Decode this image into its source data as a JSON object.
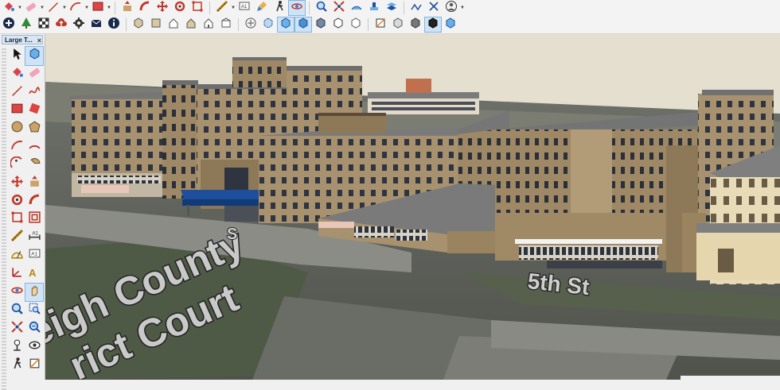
{
  "tray": {
    "title": "Large T...",
    "close_glyph": "×"
  },
  "toolbar_row1": [
    {
      "name": "paint-bucket-icon",
      "dd": true
    },
    {
      "name": "eraser-icon",
      "dd": true
    },
    {
      "name": "pencil-line-icon",
      "dd": true
    },
    {
      "name": "arc-icon",
      "dd": true
    },
    {
      "name": "rectangle-icon",
      "dd": true
    },
    {
      "name": "push-pull-icon"
    },
    {
      "name": "follow-me-icon"
    },
    {
      "name": "move-icon"
    },
    {
      "name": "rotate-icon"
    },
    {
      "name": "scale-icon"
    },
    {
      "name": "tape-measure-icon",
      "dd": true
    },
    {
      "name": "text-label-icon"
    },
    {
      "name": "paint-brush-icon"
    },
    {
      "name": "walk-icon"
    },
    {
      "name": "orbit-icon",
      "active": true
    },
    {
      "name": "zoom-icon"
    },
    {
      "name": "zoom-extents-icon"
    },
    {
      "name": "sandbox-smoove-icon"
    },
    {
      "name": "stamp-icon"
    },
    {
      "name": "drape-icon"
    },
    {
      "name": "add-detail-icon"
    },
    {
      "name": "flip-edge-icon"
    },
    {
      "name": "user-account-icon",
      "dd": true
    }
  ],
  "toolbar_row2": [
    {
      "name": "add-location-icon"
    },
    {
      "name": "tree-icon"
    },
    {
      "name": "checkerboard-icon"
    },
    {
      "name": "cloud-upload-icon"
    },
    {
      "name": "extensions-gear-icon"
    },
    {
      "name": "mail-icon"
    },
    {
      "name": "info-icon"
    },
    {
      "name": "iso-view-icon"
    },
    {
      "name": "top-view-icon"
    },
    {
      "name": "front-view-icon"
    },
    {
      "name": "right-view-icon"
    },
    {
      "name": "back-view-icon"
    },
    {
      "name": "left-view-icon"
    },
    {
      "name": "xray-icon"
    },
    {
      "name": "back-edges-icon"
    },
    {
      "name": "wireframe-icon",
      "active": true
    },
    {
      "name": "hidden-line-icon",
      "active": true
    },
    {
      "name": "shaded-icon"
    },
    {
      "name": "shaded-textures-icon"
    },
    {
      "name": "monochrome-icon"
    },
    {
      "name": "section-plane-icon"
    },
    {
      "name": "section-cut-icon"
    },
    {
      "name": "section-fill-icon"
    },
    {
      "name": "display-sections-icon",
      "active": true
    },
    {
      "name": "shadow-toggle-icon"
    }
  ],
  "tray_tools": [
    {
      "name": "select-arrow-icon"
    },
    {
      "name": "make-component-icon",
      "active": true
    },
    {
      "name": "paint-bucket-icon"
    },
    {
      "name": "eraser-icon"
    },
    {
      "name": "line-pencil-icon"
    },
    {
      "name": "freehand-icon"
    },
    {
      "name": "rectangle-icon"
    },
    {
      "name": "rotated-rectangle-icon"
    },
    {
      "name": "circle-icon"
    },
    {
      "name": "polygon-icon"
    },
    {
      "name": "arc-icon"
    },
    {
      "name": "two-point-arc-icon"
    },
    {
      "name": "three-point-arc-icon"
    },
    {
      "name": "pie-icon"
    },
    {
      "name": "move-icon"
    },
    {
      "name": "push-pull-icon"
    },
    {
      "name": "rotate-icon"
    },
    {
      "name": "follow-me-icon"
    },
    {
      "name": "scale-icon"
    },
    {
      "name": "offset-icon"
    },
    {
      "name": "tape-measure-icon"
    },
    {
      "name": "dimension-icon"
    },
    {
      "name": "protractor-icon"
    },
    {
      "name": "text-icon"
    },
    {
      "name": "axes-icon"
    },
    {
      "name": "3d-text-icon"
    },
    {
      "name": "orbit-icon"
    },
    {
      "name": "pan-hand-icon",
      "active": true
    },
    {
      "name": "zoom-icon"
    },
    {
      "name": "zoom-window-icon"
    },
    {
      "name": "zoom-extents-icon"
    },
    {
      "name": "previous-view-icon"
    },
    {
      "name": "position-camera-icon"
    },
    {
      "name": "look-around-icon"
    },
    {
      "name": "walk-icon"
    },
    {
      "name": "section-plane-icon"
    }
  ],
  "viewport": {
    "street_labels": [
      {
        "text": "eigh County",
        "role": "county-label-1"
      },
      {
        "text": "rict Court",
        "role": "county-label-2"
      },
      {
        "text": "5th St",
        "role": "street-5th"
      },
      {
        "text": "S",
        "role": "street-fragment"
      }
    ],
    "colors": {
      "brick": "#a8916e",
      "brick_dark": "#8d7858",
      "roof": "#6f6f6f",
      "canopy": "#1d4f9c",
      "sky": "#e4dfce",
      "ground": "#5b5f56",
      "cream": "#e8dcb8",
      "accent_red": "#c0704e"
    }
  }
}
